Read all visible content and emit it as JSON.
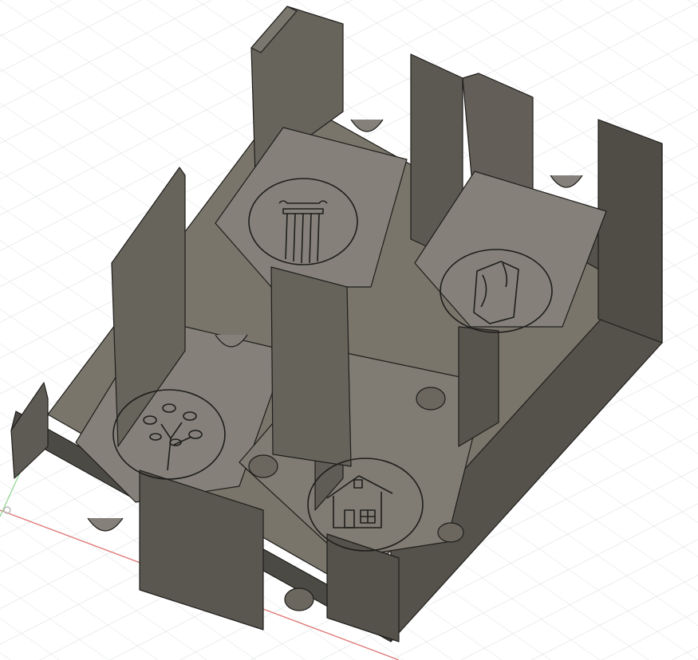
{
  "viewport": {
    "background": "#ffffff",
    "grid_color": "#d6d9dc",
    "x_axis_color": "#e07a7a",
    "y_axis_color": "#8bd48b"
  },
  "model": {
    "body_color": "#5a5750",
    "body_dark": "#3f3d38",
    "body_light": "#6e6b63",
    "floor_color": "#767268",
    "edge_color": "#1f1e1b",
    "compartments": [
      {
        "name": "compartment-column",
        "emblem": "greek-column-icon"
      },
      {
        "name": "compartment-can",
        "emblem": "crushed-can-icon"
      },
      {
        "name": "compartment-tree",
        "emblem": "tree-icon"
      },
      {
        "name": "compartment-house",
        "emblem": "house-icon"
      }
    ]
  }
}
